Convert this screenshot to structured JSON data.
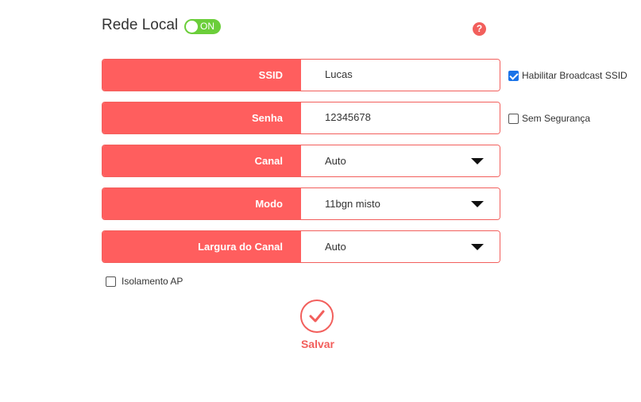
{
  "header": {
    "title": "Rede Local",
    "toggle_label": "ON",
    "help_label": "?"
  },
  "form": {
    "ssid": {
      "label": "SSID",
      "value": "Lucas"
    },
    "password": {
      "label": "Senha",
      "value": "12345678"
    },
    "channel": {
      "label": "Canal",
      "value": "Auto"
    },
    "mode": {
      "label": "Modo",
      "value": "11bgn misto"
    },
    "channel_width": {
      "label": "Largura do Canal",
      "value": "Auto"
    }
  },
  "options": {
    "broadcast_ssid": {
      "label": "Habilitar Broadcast SSID",
      "checked": true
    },
    "no_security": {
      "label": "Sem Segurança",
      "checked": false
    },
    "ap_isolation": {
      "label": "Isolamento AP",
      "checked": false
    }
  },
  "save": {
    "label": "Salvar"
  },
  "colors": {
    "accent": "#ff5e5e",
    "toggle_on": "#6bce3a",
    "checkbox_checked": "#1a73e8"
  }
}
